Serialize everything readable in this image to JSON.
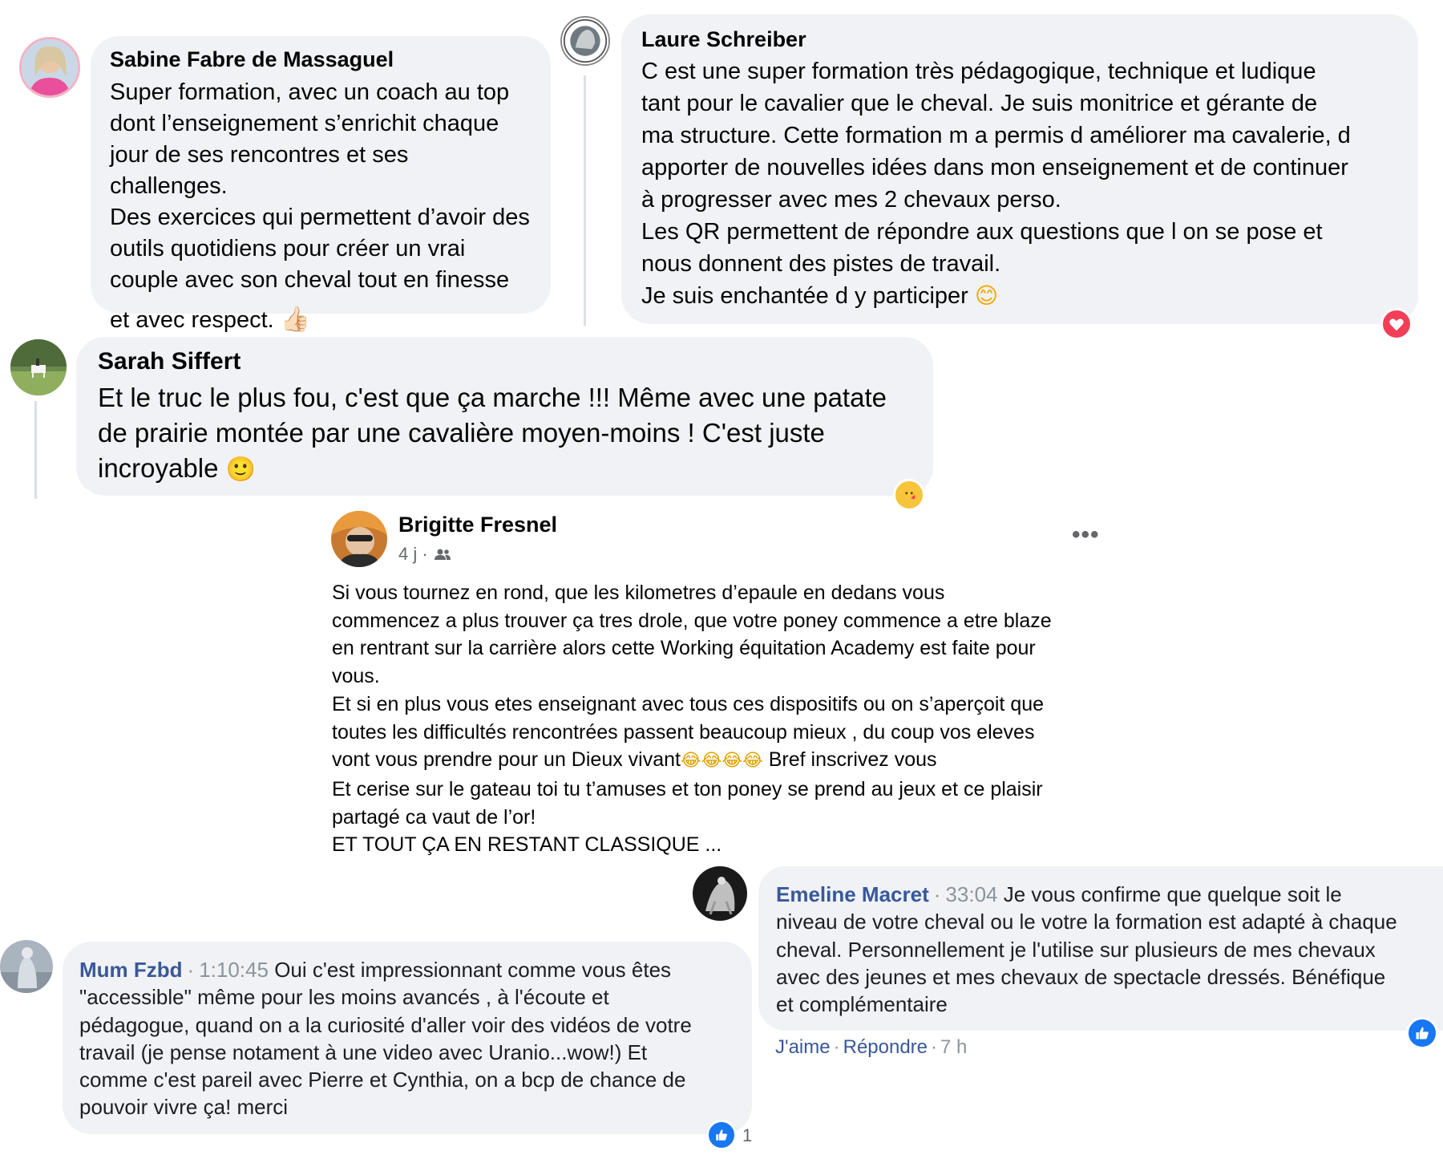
{
  "comments": [
    {
      "author": "Sabine Fabre de Massaguel",
      "text": "Super formation, avec un coach au top\ndont l’enseignement s’enrichit chaque\njour de ses rencontres et ses challenges.\nDes exercices qui permettent d’avoir des\noutils quotidiens pour créer un vrai\ncouple avec son cheval tout en finesse",
      "text_last": "et avec respect.",
      "emoji": "👍🏻"
    },
    {
      "author": "Laure Schreiber",
      "text": "C est une super formation très pédagogique, technique et ludique\ntant pour le cavalier que le cheval. Je suis monitrice et gérante de\nma structure. Cette formation m a permis d améliorer ma cavalerie, d\napporter de nouvelles idées dans mon enseignement et de continuer\nà progresser avec mes 2 chevaux perso.\nLes QR permettent de répondre aux questions que l on se pose et\nnous donnent des pistes de travail.\nJe suis enchantée d y participer",
      "emoji": "😊",
      "reaction": "heart"
    },
    {
      "author": "Sarah Siffert",
      "text": "Et le truc le plus fou, c'est que ça marche !!! Même avec une patate\nde prairie montée par une cavalière moyen-moins ! C'est juste\nincroyable",
      "emoji": "🙂",
      "reaction": "care"
    }
  ],
  "post": {
    "author": "Brigitte Fresnel",
    "time": "4 j ·",
    "audience_icon": "friends-icon",
    "text_part1": "Si vous tournez en rond, que les kilometres d’epaule en dedans  vous\ncommencez a plus trouver ça tres drole, que votre poney commence a etre blaze\nen rentrant sur la carrière alors cette Working équitation Academy est faite pour\nvous.\nEt si en plus vous etes enseignant avec tous ces dispositifs ou on s’aperçoit que\ntoutes les difficultés rencontrées passent beaucoup mieux , du coup vos eleves\nvont vous prendre pour un Dieux vivant",
    "laugh_emojis": "😂😂😂😂",
    "text_part2": " Bref inscrivez vous\nEt cerise sur le gateau toi tu t’amuses et ton poney se prend au jeux  et ce plaisir\npartagé ca vaut de l’or!\nET TOUT ÇA EN RESTANT CLASSIQUE ...",
    "more": "•••"
  },
  "old_comments": [
    {
      "author": "Emeline Macret",
      "timestamp": "33:04",
      "text": "Je vous confirme que quelque soit le\nniveau de votre cheval ou le votre la formation est adapté à chaque\ncheval. Personnellement je l'utilise sur plusieurs de mes chevaux\navec des jeunes et mes chevaux de spectacle dressés. Bénéfique\net complémentaire",
      "actions": {
        "like": "J'aime",
        "reply": "Répondre",
        "time": "7 h"
      },
      "reaction": "like"
    },
    {
      "author": "Mum Fzbd",
      "timestamp": "1:10:45",
      "text": "Oui c'est impressionnant comme vous êtes\n\"accessible\" même pour les moins avancés , à l'écoute et\npédagogue, quand on a la curiosité d'aller voir des vidéos de votre\ntravail (je pense notament à une video avec Uranio...wow!) Et\ncomme c'est pareil avec Pierre et Cynthia, on a bcp de chance de\npouvoir vivre ça! merci",
      "reaction": "like",
      "reaction_count": "1"
    }
  ],
  "colors": {
    "bubble": "#f0f2f5",
    "name_link": "#385898",
    "meta": "#65676b",
    "like_blue": "#1877f2",
    "heart_red": "#f33e58"
  }
}
